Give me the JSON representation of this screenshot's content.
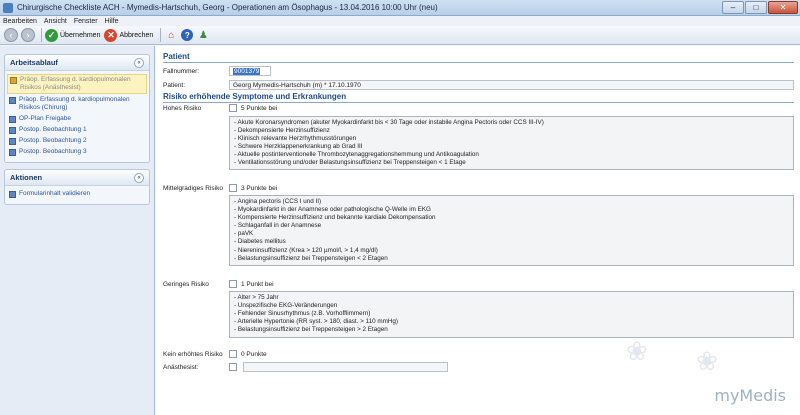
{
  "window": {
    "title": "Chirurgische Checkliste ACH - Mymedis-Hartschuh, Georg - Operationen am Ösophagus - 13.04.2016 10:00 Uhr (neu)",
    "controls": {
      "minimize": "–",
      "maximize": "□",
      "close": "✕"
    }
  },
  "menu": {
    "items": [
      "Bearbeiten",
      "Ansicht",
      "Fenster",
      "Hilfe"
    ]
  },
  "toolbar": {
    "back": "‹",
    "forward": "›",
    "accept_label": "Übernehmen",
    "cancel_label": "Abbrechen",
    "home": "⌂",
    "help": "?",
    "user": "♟"
  },
  "sidebar": {
    "workflow": {
      "title": "Arbeitsablauf",
      "collapse": "«",
      "items": [
        {
          "label": "Präop. Erfassung d. kardiopulmonalen Risikos (Anästhesist)",
          "active": true
        },
        {
          "label": "Präop. Erfassung d. kardiopulmonalen Risikos (Chirurg)",
          "active": false
        },
        {
          "label": "OP-Plan Freigabe",
          "active": false
        },
        {
          "label": "Postop. Beobachtung 1",
          "active": false
        },
        {
          "label": "Postop. Beobachtung 2",
          "active": false
        },
        {
          "label": "Postop. Beobachtung 3",
          "active": false
        }
      ]
    },
    "actions": {
      "title": "Aktionen",
      "collapse": "«",
      "items": [
        {
          "label": "Formularinhalt validieren"
        }
      ]
    }
  },
  "main": {
    "patient_section": {
      "title": "Patient",
      "case_label": "Fallnummer:",
      "case_value": "9001379",
      "patient_label": "Patient:",
      "patient_value": "Georg Mymedis-Hartschuh (m) * 17.10.1970"
    },
    "risk_section": {
      "title": "Risiko erhöhende Symptome und Erkrankungen",
      "high": {
        "label": "Hohes Risiko",
        "points": "5 Punkte bei",
        "items": [
          "- Akute Koronarsyndromen (akuter Myokardinfarkt bis < 30 Tage oder instabile Angina Pectoris oder CCS III-IV)",
          "- Dekompensierte Herzinsuffizienz",
          "- Klinisch relevante Herzrhythmusstörungen",
          "- Schwere Herzklappenerkrankung ab Grad III",
          "- Aktuelle postinterventionelle Thrombozytenaggregationshemmung und Antikoagulation",
          "- Ventilationsstörung und/oder Belastungsinsuffizienz bei Treppensteigen < 1 Etage"
        ]
      },
      "medium": {
        "label": "Mittelgradiges Risiko",
        "points": "3 Punkte bei",
        "items": [
          "- Angina pectoris (CCS I und II)",
          "- Myokardinfarkt in der Anamnese oder pathologische Q-Welle im EKG",
          "- Kompensierte Herzinsuffizienz und bekannte kardiale Dekompensation",
          "- Schlaganfall in der Anamnese",
          "- paVK",
          "- Diabetes mellitus",
          "- Niereninsuffizienz (Krea > 120 µmol/l, > 1,4 mg/dl)",
          "- Belastungsinsuffizienz bei Treppensteigen < 2 Etagen"
        ]
      },
      "low": {
        "label": "Geringes Risiko",
        "points": "1 Punkt bei",
        "items": [
          "- Alter > 75 Jahr",
          "- Unspezifische EKG-Veränderungen",
          "- Fehlender Sinusrhythmus (z.B. Vorhofflimmern)",
          "- Arterielle Hypertonie (RR syst. > 180, diast. > 110 mmHg)",
          "- Belastungsinsuffizienz bei Treppensteigen > 2 Etagen"
        ]
      },
      "none": {
        "label": "Kein erhöhtes Risiko",
        "points": "0 Punkte"
      },
      "anesthetist": {
        "label": "Anästhesist:",
        "value": ""
      }
    },
    "logo": "myMedis"
  }
}
